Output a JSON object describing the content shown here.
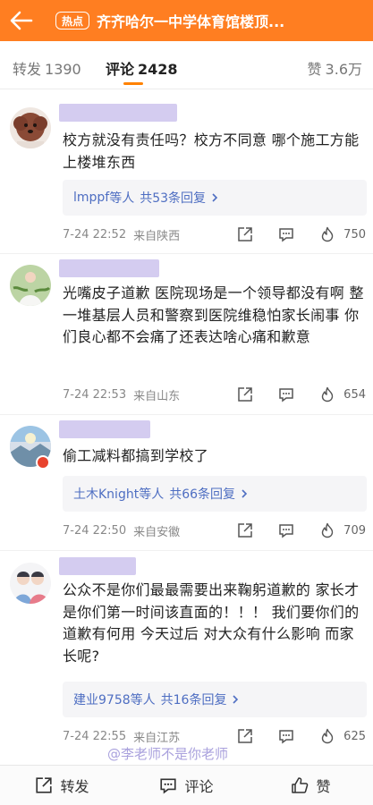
{
  "header": {
    "back_icon": "arrow-left-icon",
    "hot_badge": "热点",
    "title": "齐齐哈尔一中学体育馆楼顶..."
  },
  "tabs": {
    "repost_label": "转发",
    "repost_count": "1390",
    "comment_label": "评论",
    "comment_count": "2428",
    "like_label": "赞",
    "like_count": "3.6万"
  },
  "comments": [
    {
      "text": "校方就没有责任吗？校方不同意 哪个施工方能上楼堆东西",
      "replies_who": "lmppf",
      "replies_etc": "等人",
      "replies_count": "共53条回复",
      "time": "7-24 22:52",
      "location": "来自陕西",
      "likes": "750"
    },
    {
      "text": "光嘴皮子道歉 医院现场是一个领导都没有啊 整一堆基层人员和警察到医院维稳怕家长闹事 你们良心都不会痛了还表达啥心痛和歉意",
      "time": "7-24 22:53",
      "location": "来自山东",
      "likes": "654"
    },
    {
      "text": "偷工减料都搞到学校了",
      "replies_who": "土木Knight",
      "replies_etc": "等人",
      "replies_count": "共66条回复",
      "time": "7-24 22:50",
      "location": "来自安徽",
      "likes": "709"
    },
    {
      "text": "公众不是你们最最需要出来鞠躬道歉的 家长才是你们第一时间该直面的！！！ 我们要你们的道歉有何用 今天过后 对大众有什么影响 而家长呢?",
      "replies_who": "建业9758",
      "replies_etc": "等人",
      "replies_count": "共16条回复",
      "time": "7-24 22:55",
      "location": "来自江苏",
      "likes": "625"
    }
  ],
  "watermark": "@李老师不是你老师",
  "bottom_bar": {
    "repost": "转发",
    "comment": "评论",
    "like": "赞"
  },
  "colors": {
    "header_bg": "#ff7e21",
    "link": "#4e6ec2",
    "tab_underline": "#ff8200"
  }
}
